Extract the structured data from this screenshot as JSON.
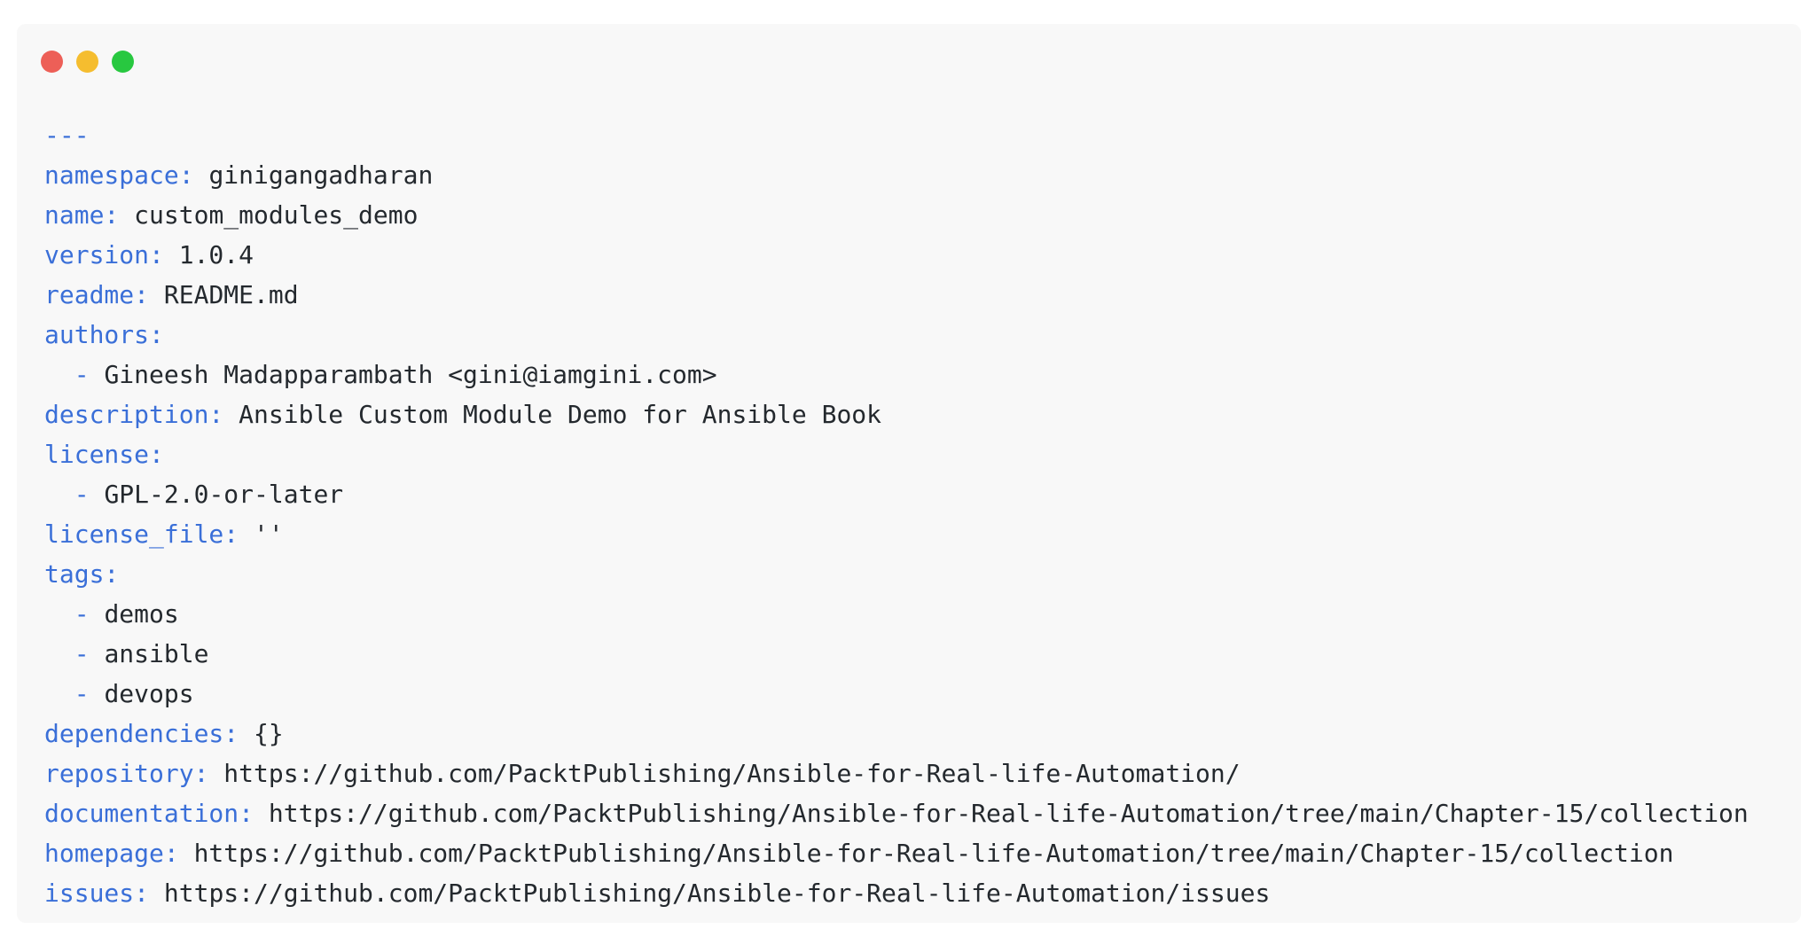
{
  "window": {
    "controls": {
      "close_color": "#ed5f57",
      "minimize_color": "#f5bd2f",
      "maximize_color": "#28c840"
    }
  },
  "colors": {
    "key": "#3a6fd8",
    "value": "#24292e",
    "background": "#f8f8f8"
  },
  "code": {
    "lines": [
      {
        "type": "marker",
        "key": "---",
        "value": ""
      },
      {
        "type": "pair",
        "key": "namespace:",
        "value": "ginigangadharan"
      },
      {
        "type": "pair",
        "key": "name:",
        "value": "custom_modules_demo"
      },
      {
        "type": "pair",
        "key": "version:",
        "value": "1.0.4"
      },
      {
        "type": "pair",
        "key": "readme:",
        "value": "README.md"
      },
      {
        "type": "pair",
        "key": "authors:",
        "value": ""
      },
      {
        "type": "item",
        "key": "-",
        "value": "Gineesh Madapparambath <gini@iamgini.com>"
      },
      {
        "type": "pair",
        "key": "description:",
        "value": "Ansible Custom Module Demo for Ansible Book"
      },
      {
        "type": "pair",
        "key": "license:",
        "value": ""
      },
      {
        "type": "item",
        "key": "-",
        "value": "GPL-2.0-or-later"
      },
      {
        "type": "pair",
        "key": "license_file:",
        "value": "''"
      },
      {
        "type": "pair",
        "key": "tags:",
        "value": ""
      },
      {
        "type": "item",
        "key": "-",
        "value": "demos"
      },
      {
        "type": "item",
        "key": "-",
        "value": "ansible"
      },
      {
        "type": "item",
        "key": "-",
        "value": "devops"
      },
      {
        "type": "pair",
        "key": "dependencies:",
        "value": "{}"
      },
      {
        "type": "pair",
        "key": "repository:",
        "value": "https://github.com/PacktPublishing/Ansible-for-Real-life-Automation/"
      },
      {
        "type": "pair",
        "key": "documentation:",
        "value": "https://github.com/PacktPublishing/Ansible-for-Real-life-Automation/tree/main/Chapter-15/collection"
      },
      {
        "type": "pair",
        "key": "homepage:",
        "value": "https://github.com/PacktPublishing/Ansible-for-Real-life-Automation/tree/main/Chapter-15/collection"
      },
      {
        "type": "pair",
        "key": "issues:",
        "value": "https://github.com/PacktPublishing/Ansible-for-Real-life-Automation/issues"
      }
    ]
  }
}
